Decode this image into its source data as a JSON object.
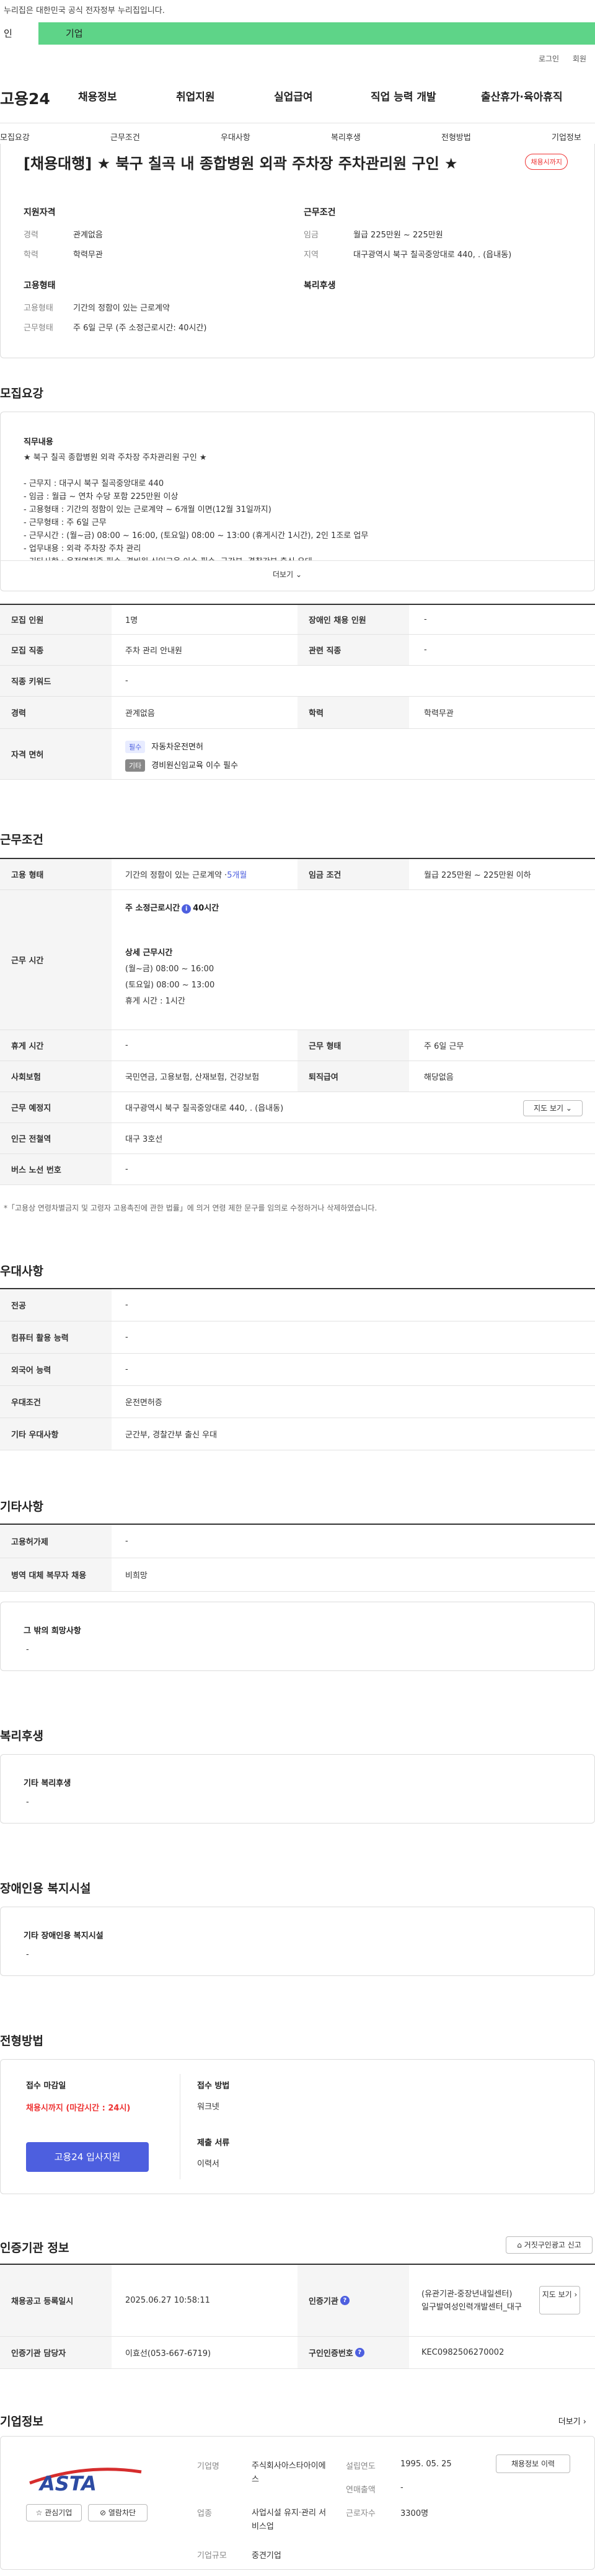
{
  "gov_notice": "누리집은 대한민국 공식 전자정부 누리집입니다.",
  "segments": [
    "인",
    "기업"
  ],
  "util": [
    "로그인",
    "회원"
  ],
  "logo": "고용24",
  "gnb": [
    "채용정보",
    "취업지원",
    "실업급여",
    "직업 능력 개발",
    "출산휴가·육아휴직"
  ],
  "subnav": [
    "모집요강",
    "근무조건",
    "우대사항",
    "복리후생",
    "전형방법",
    "기업정보"
  ],
  "job": {
    "title": "[채용대행] ★ 북구 칠곡 내 종합병원 외곽 주차장 주차관리원 구인 ★",
    "badge": "채용시까지",
    "sections": {
      "qual": "지원자격",
      "cond": "근무조건",
      "emp": "고용형태",
      "welfare": "복리후생"
    },
    "fields": {
      "career_l": "경력",
      "career_v": "관계없음",
      "edu_l": "학력",
      "edu_v": "학력무관",
      "wage_l": "임금",
      "wage_v": "월급 225만원 ~ 225만원",
      "loc_l": "지역",
      "loc_v": "대구광역시 북구 칠곡중앙대로 440, . (읍내동)",
      "type_l": "고용형태",
      "type_v": "기간의 정함이 있는 근로계약",
      "form_l": "근무형태",
      "form_v": "주 6일 근무 (주 소정근로시간: 40시간)"
    }
  },
  "recruit": {
    "heading": "모집요강",
    "duty_title": "직무내용",
    "duty_text": "★ 북구 칠곡 종합병원 외곽 주차장 주차관리원 구인 ★\n\n- 근무지 : 대구시 북구 칠곡중앙대로 440\n- 임금 : 월급 ~ 연차 수당 포함 225만원 이상\n- 고용형태 : 기간의 정함이 있는 근로계약 ~ 6개월 이면(12월 31일까지)\n- 근무형태 : 주 6일 근무\n- 근무시간 : (월~금) 08:00 ~ 16:00, (토요일) 08:00 ~ 13:00 (휴게시간 1시간), 2인 1조로 업무\n- 업무내용 : 외곽 주차장 주차 관리\n- 기타사항 : 운전면허증 필수, 경비원 신임교육 이수 필수, 군간부, 경찰간부 출신 우대",
    "more": "더보기",
    "rows": {
      "cnt_l": "모집 인원",
      "cnt_v": "1명",
      "dis_l": "장애인 채용 인원",
      "dis_v": "-",
      "job_l": "모집 직종",
      "job_v": "주차 관리 안내원",
      "rel_l": "관련 직종",
      "rel_v": "-",
      "kw_l": "직종 키워드",
      "kw_v": "-",
      "career_l": "경력",
      "career_v": "관계없음",
      "edu_l": "학력",
      "edu_v": "학력무관",
      "lic_l": "자격 면허",
      "lic1_chip": "필수",
      "lic1": "자동차운전면허",
      "lic2_chip": "기타",
      "lic2": "경비원신임교육 이수 필수"
    }
  },
  "work": {
    "heading": "근무조건",
    "type_l": "고용 형태",
    "type_v": "기간의 정함이 있는 근로계약 · ",
    "type_v2": "5개월",
    "wage_l": "임금 조건",
    "wage_v": "월급 225만원 ~ 225만원 이하",
    "hours_l": "근무 시간",
    "hours_main": "주 소정근로시간",
    "hours_main_v": "40시간",
    "hours_detail": "상세 근무시간",
    "hours_1": "(월~금) 08:00 ~ 16:00",
    "hours_2": "(토요일) 08:00 ~ 13:00",
    "hours_3": "휴게 시간 : 1시간",
    "rest_l": "휴게 시간",
    "rest_v": "-",
    "form_l": "근무 형태",
    "form_v": "주 6일 근무",
    "ins_l": "사회보험",
    "ins_v": "국민연금, 고용보험, 산재보험, 건강보험",
    "ret_l": "퇴직급여",
    "ret_v": "해당없음",
    "place_l": "근무 예정지",
    "place_v": "대구광역시 북구 칠곡중앙대로 440, . (읍내동)",
    "map_btn": "지도 보기",
    "subway_l": "인근 전철역",
    "subway_v": "대구 3호선",
    "bus_l": "버스 노선 번호",
    "bus_v": "-",
    "note": "*「고용상 연령차별금지 및 고령자 고용촉진에 관한 법률」에 의거 연령 제한 문구를 임의로 수정하거나 삭제하였습니다."
  },
  "pref": {
    "heading": "우대사항",
    "major_l": "전공",
    "major_v": "-",
    "pc_l": "컴퓨터 활용 능력",
    "pc_v": "-",
    "lang_l": "외국어 능력",
    "lang_v": "-",
    "cond_l": "우대조건",
    "cond_v": "운전면허증",
    "etc_l": "기타 우대사항",
    "etc_v": "군간부, 경찰간부 출신 우대"
  },
  "other": {
    "heading": "기타사항",
    "permit_l": "고용허가제",
    "permit_v": "-",
    "mil_l": "병역 대체 복무자 채용",
    "mil_v": "비희망",
    "wish_title": "그 밖의 희망사항",
    "wish_v": "-"
  },
  "benefit": {
    "heading": "복리후생",
    "title": "기타 복리후생",
    "value": "-"
  },
  "facility": {
    "heading": "장애인용 복지시설",
    "title": "기타 장애인용 복지시설",
    "value": "-"
  },
  "process": {
    "heading": "전형방법",
    "deadline_title": "접수 마감일",
    "deadline_v": "채용시까지 (마감시간 : 24시)",
    "apply_btn": "고용24 입사지원",
    "method_title": "접수 방법",
    "method_v": "워크넷",
    "docs_title": "제출 서류",
    "docs_v": "이력서"
  },
  "cert": {
    "heading": "인증기관 정보",
    "report_btn": "거짓구인광고 신고",
    "reg_l": "채용공고 등록일시",
    "reg_v": "2025.06.27 10:58:11",
    "org_l": "인증기관",
    "org_v": "(유관기관-중장년내일센터)\n일구발여성인력개발센터_대구",
    "org_btn": "지도 보기",
    "mgr_l": "인증기관 담당자",
    "mgr_v": "이효선(053-667-6719)",
    "no_l": "구인인증번호",
    "no_v": "KEC0982506270002"
  },
  "company": {
    "heading": "기업정보",
    "more": "더보기",
    "logo_text": "ASTA",
    "interest_btn": "관심기업",
    "block_btn": "열람차단",
    "name_l": "기업명",
    "name_v": "주식회사아스타아이에스",
    "biz_l": "업종",
    "biz_v": "사업시설 유지·관리 서비스업",
    "size_l": "기업규모",
    "size_v": "중견기업",
    "est_l": "설립연도",
    "est_v": "1995. 05. 25",
    "rev_l": "연매출액",
    "rev_v": "-",
    "emp_l": "근로자수",
    "emp_v": "3300명",
    "info_btn": "채용정보 이력"
  },
  "colors": {
    "accent": "#4d5fdf",
    "green": "#5ed488",
    "red": "#e33333"
  }
}
